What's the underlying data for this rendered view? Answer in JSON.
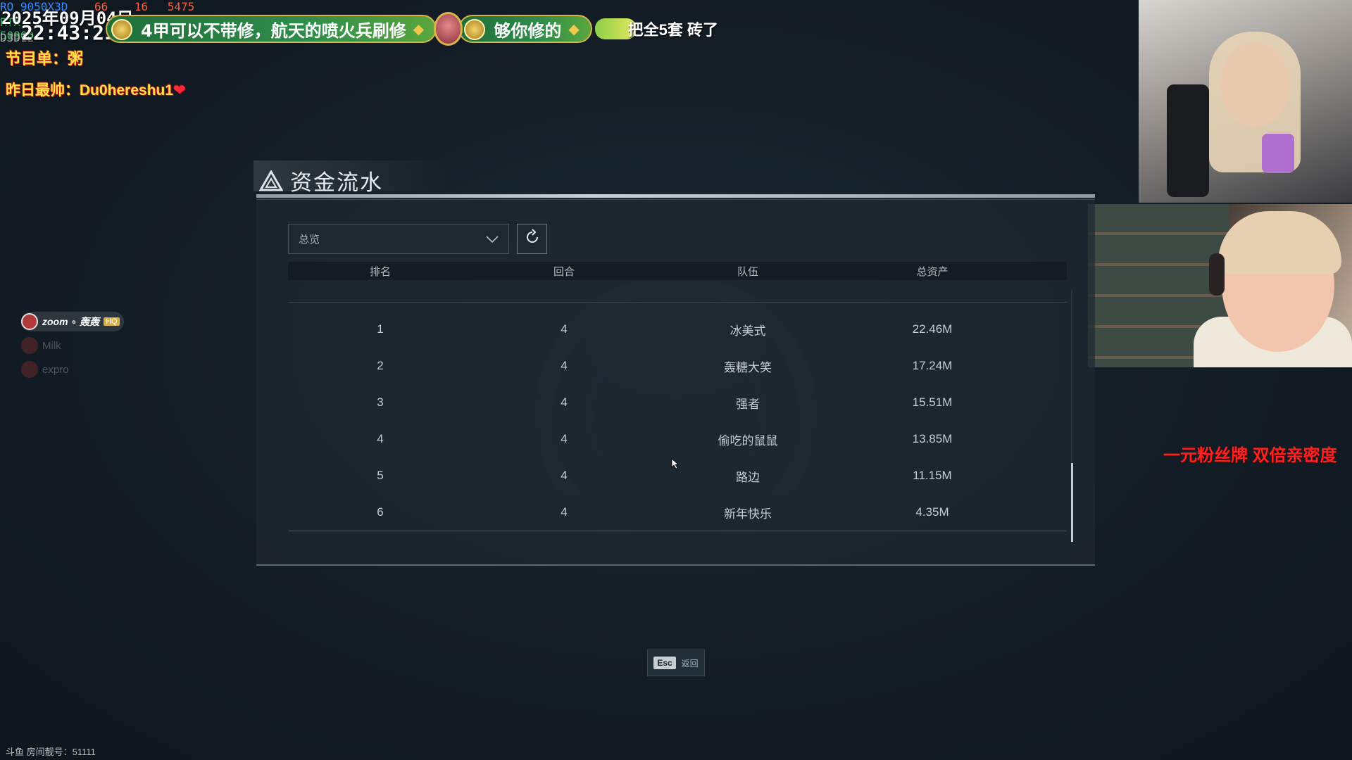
{
  "stream_overlay": {
    "gpu_readout": "RO 9050X3D",
    "gpu_percent": "66",
    "cpu_percent": "16",
    "clock_mhz": "5475",
    "date": "2025年09月04日",
    "time": "22:43:21",
    "gpu_model": "RTX 5090D",
    "d3d": "D3D12",
    "danmu_1": "4甲可以不带修，航天的喷火兵刷修",
    "danmu_2": "够你修的",
    "danmu_3": "把全5套 砖了",
    "program_label": "节目单：粥",
    "best_label": "昨日最帅：Du0hereshu1",
    "heart": "❤",
    "viewers": [
      {
        "name": "zoom ∘ 轰轰"
      },
      {
        "name": "Milk"
      },
      {
        "name": "expro"
      }
    ],
    "fan_badge_text": "一元粉丝牌 双倍亲密度",
    "room_label": "斗鱼 房间靓号：51111"
  },
  "panel": {
    "title": "资金流水",
    "filter": {
      "selected": "总览"
    },
    "columns": {
      "rank": "排名",
      "round": "回合",
      "team": "队伍",
      "assets": "总资产"
    },
    "rows": [
      {
        "rank": "1",
        "round": "4",
        "team": "冰美式",
        "assets": "22.46M"
      },
      {
        "rank": "2",
        "round": "4",
        "team": "轰糖大笑",
        "assets": "17.24M"
      },
      {
        "rank": "3",
        "round": "4",
        "team": "强者",
        "assets": "15.51M"
      },
      {
        "rank": "4",
        "round": "4",
        "team": "偷吃的鼠鼠",
        "assets": "13.85M"
      },
      {
        "rank": "5",
        "round": "4",
        "team": "路边",
        "assets": "11.15M"
      },
      {
        "rank": "6",
        "round": "4",
        "team": "新年快乐",
        "assets": "4.35M"
      }
    ],
    "esc_key": "Esc",
    "esc_label": "返回"
  },
  "colors": {
    "accent_gold": "#d7b24a",
    "fan_badge_red": "#ff2020",
    "program_yellow": "#ffe14a"
  }
}
